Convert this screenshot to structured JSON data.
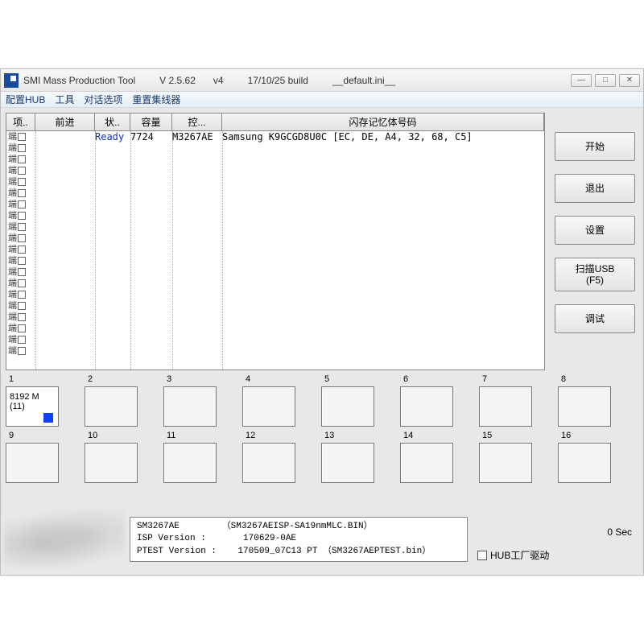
{
  "titlebar": {
    "app_name": "SMI Mass Production Tool",
    "version": "V 2.5.62",
    "subver": "v4",
    "build": "17/10/25 build",
    "config_file": "__default.ini__"
  },
  "window_controls": {
    "minimize": "—",
    "maximize": "□",
    "close": "✕"
  },
  "menu": {
    "hub": "配置HUB",
    "tools": "工具",
    "dialog": "对话选项",
    "reset_hub": "重置集线器"
  },
  "grid": {
    "headers": {
      "item": "项..",
      "forward": "前进",
      "state": "状..",
      "capacity": "容量",
      "ctrl": "控...",
      "flash": "闪存记忆体号码"
    },
    "row_label_char": "端",
    "num_rows": 20,
    "data_row": {
      "state": "Ready",
      "capacity": "7724",
      "ctrl": "M3267AE",
      "flash": "Samsung K9GCGD8U0C [EC, DE, A4, 32, 68, C5]"
    }
  },
  "buttons": {
    "start": "开始",
    "exit": "退出",
    "settings": "设置",
    "scan_usb": "扫描USB\n(F5)",
    "debug": "调试"
  },
  "ports": {
    "count": 16,
    "slot1": {
      "line1": "8192 M",
      "line2": "(11)"
    }
  },
  "info_box": {
    "line1": "SM3267AE        （SM3267AEISP-SA19nmMLC.BIN）",
    "line2": "ISP Version :       170629-0AE",
    "line3": "PTEST Version :    170509_07C13 PT （SM3267AEPTEST.bin）"
  },
  "hub_checkbox_label": "HUB工厂驱动",
  "timer_label": "0 Sec"
}
